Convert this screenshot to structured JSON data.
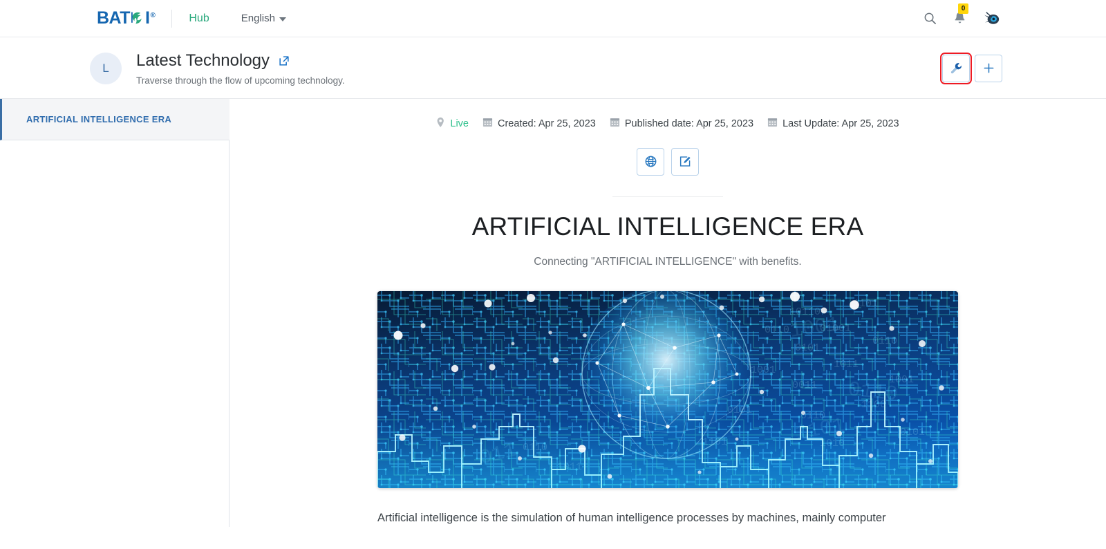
{
  "topnav": {
    "logo_text": "BAT",
    "logo_text_tail": "I",
    "logo_reg": "®",
    "hub_label": "Hub",
    "language_label": "English",
    "search_icon": "search-icon",
    "notification_icon": "bell-icon",
    "notification_count": "0",
    "avatar_icon": "user-avatar-icon"
  },
  "page_header": {
    "avatar_initial": "L",
    "title": "Latest Technology",
    "external_link_icon": "external-link-icon",
    "subtitle": "Traverse through the flow of upcoming technology.",
    "settings_button_icon": "wrench-icon",
    "add_button_icon": "plus-icon",
    "highlight_color": "#ee1b24"
  },
  "sidebar": {
    "items": [
      {
        "label": "ARTIFICIAL INTELLIGENCE ERA",
        "active": true
      }
    ],
    "active_color": "#2f6cad"
  },
  "content": {
    "meta": [
      {
        "icon": "map-pin-icon",
        "label": "Live",
        "status": true
      },
      {
        "icon": "calendar-icon",
        "label": "Created: Apr 25, 2023"
      },
      {
        "icon": "calendar-icon",
        "label": "Published date: Apr 25, 2023"
      },
      {
        "icon": "calendar-icon",
        "label": "Last Update: Apr 25, 2023"
      }
    ],
    "live_color": "#2ec08c",
    "actions": [
      {
        "icon": "globe-icon",
        "name": "preview-button"
      },
      {
        "icon": "edit-pencil-icon",
        "name": "edit-button"
      }
    ],
    "article_title": "ARTIFICIAL INTELLIGENCE ERA",
    "article_subtitle": "Connecting \"ARTIFICIAL INTELLIGENCE\" with benefits.",
    "banner_alt": "ai-circuit-city-banner-image",
    "article_body": "Artificial intelligence is the simulation of human intelligence processes by machines, mainly computer"
  }
}
